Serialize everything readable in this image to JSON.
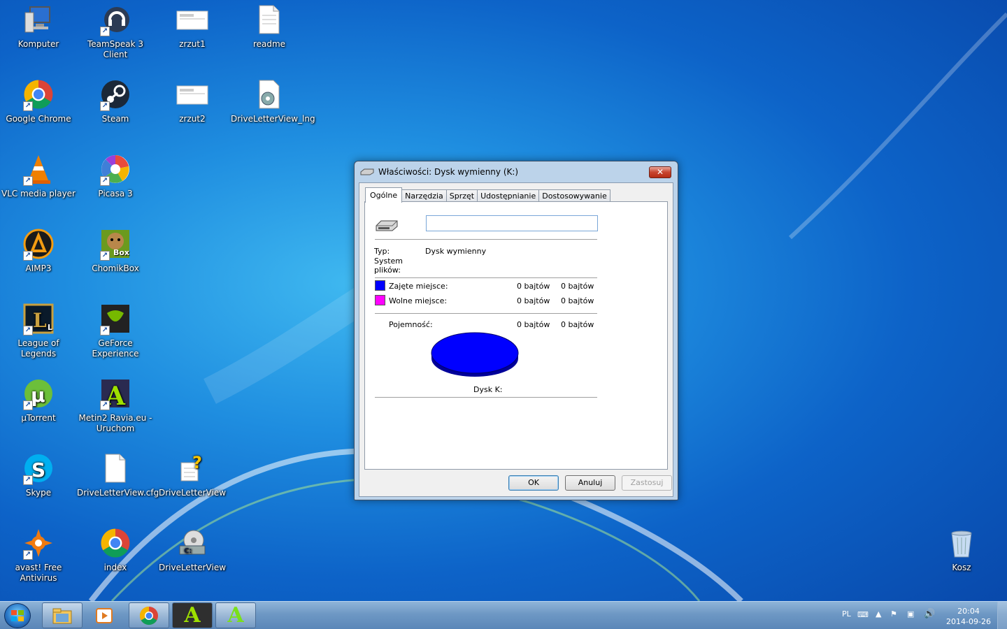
{
  "desktop_icons": [
    {
      "label": "Komputer",
      "icon": "computer-icon"
    },
    {
      "label": "TeamSpeak 3 Client",
      "icon": "teamspeak-icon"
    },
    {
      "label": "zrzut1",
      "icon": "image-file-icon"
    },
    {
      "label": "readme",
      "icon": "text-file-icon"
    },
    {
      "label": "Google Chrome",
      "icon": "chrome-icon"
    },
    {
      "label": "Steam",
      "icon": "steam-icon"
    },
    {
      "label": "zrzut2",
      "icon": "image-file-icon"
    },
    {
      "label": "DriveLetterView_lng",
      "icon": "settings-file-icon"
    },
    {
      "label": "VLC media player",
      "icon": "vlc-icon"
    },
    {
      "label": "Picasa 3",
      "icon": "picasa-icon"
    },
    {
      "label": "AIMP3",
      "icon": "aimp-icon"
    },
    {
      "label": "ChomikBox",
      "icon": "chomikbox-icon",
      "badge": "Box"
    },
    {
      "label": "League of Legends",
      "icon": "lol-icon",
      "badge": "L"
    },
    {
      "label": "GeForce Experience",
      "icon": "geforce-icon"
    },
    {
      "label": "µTorrent",
      "icon": "utorrent-icon"
    },
    {
      "label": "Metin2 Ravia.eu - Uruchom",
      "icon": "metin2-icon"
    },
    {
      "label": "Skype",
      "icon": "skype-icon"
    },
    {
      "label": "DriveLetterView.cfg",
      "icon": "blank-file-icon"
    },
    {
      "label": "DriveLetterView",
      "icon": "help-file-icon"
    },
    {
      "label": "avast! Free Antivirus",
      "icon": "avast-icon"
    },
    {
      "label": "index",
      "icon": "chrome-icon"
    },
    {
      "label": "DriveLetterView",
      "icon": "drive-app-icon"
    },
    {
      "label": "Kosz",
      "icon": "recycle-bin-icon"
    }
  ],
  "dialog": {
    "title": "Właściwości: Dysk wymienny (K:)",
    "close_label": "✕",
    "tabs": [
      "Ogólne",
      "Narzędzia",
      "Sprzęt",
      "Udostępnianie",
      "Dostosowywanie"
    ],
    "name_value": "",
    "type_label": "Typ:",
    "type_value": "Dysk wymienny",
    "fs_label_1": "System",
    "fs_label_2": "plików:",
    "used_label": "Zajęte miejsce:",
    "used_bytes": "0 bajtów",
    "used_size": "0 bajtów",
    "free_label": "Wolne miejsce:",
    "free_bytes": "0 bajtów",
    "free_size": "0 bajtów",
    "capacity_label": "Pojemność:",
    "capacity_bytes": "0 bajtów",
    "capacity_size": "0 bajtów",
    "drive_caption": "Dysk K:",
    "ok": "OK",
    "cancel": "Anuluj",
    "apply": "Zastosuj",
    "colors": {
      "used": "#0000ff",
      "free": "#ff00ff"
    }
  },
  "taskbar": {
    "lang": "PL",
    "time": "20:04",
    "date": "2014-09-26"
  }
}
